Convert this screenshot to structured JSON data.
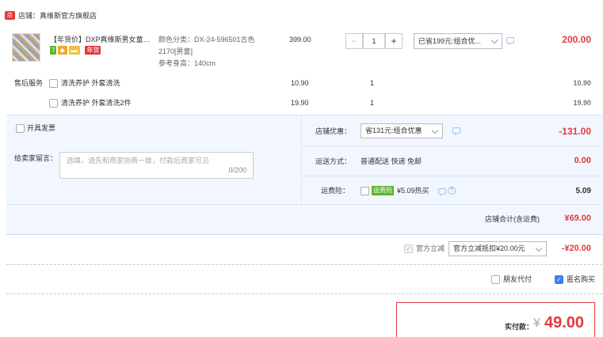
{
  "shop": {
    "label": "店铺：真维斯官方旗舰店"
  },
  "product": {
    "title": "【年货价】DXP真维斯男女童夏...",
    "badge_7": "7",
    "badge_nian": "年货",
    "spec_line1": "颜色分类：DX-24-596501古色",
    "spec_line2": "2170[男童]",
    "spec_line3": "参考身高：140cm",
    "price": "399.00",
    "qty": "1",
    "promo_select": "已省199元:组合优...",
    "subtotal": "200.00"
  },
  "after_sales": {
    "label": "售后服务",
    "items": [
      {
        "name": "清洗养护 外套清洗",
        "price": "10.90",
        "qty": "1",
        "subtotal": "10.90"
      },
      {
        "name": "清洗养护 外套清洗2件",
        "price": "19.90",
        "qty": "1",
        "subtotal": "19.90"
      }
    ]
  },
  "invoice": {
    "label": "开具发票"
  },
  "message": {
    "label": "给卖家留言：",
    "placeholder": "选填，请先和商家协商一致，付款后商家可见",
    "counter": "0/200"
  },
  "discount": {
    "label": "店铺优惠：",
    "select": "省131元:组合优惠",
    "value": "-131.00"
  },
  "shipping": {
    "label": "运送方式：",
    "text": "普通配送 快递 免邮",
    "value": "0.00"
  },
  "insurance": {
    "label": "运费险：",
    "tag": "运费险",
    "text": "¥5.09热买",
    "value": "5.09"
  },
  "shop_total": {
    "label": "店铺合计(含运费)",
    "value": "¥69.00"
  },
  "official_discount": {
    "label": "官方立减",
    "select": "官方立减抵扣¥20.00元",
    "value": "-¥20.00"
  },
  "options": {
    "friend_pay": "朋友代付",
    "anonymous": "匿名购买"
  },
  "payment": {
    "label": "实付款：",
    "currency": "¥",
    "value": "49.00"
  },
  "colors": {
    "accent": "#e4393c",
    "band": "#f2f7ff",
    "badge_green": "#5ab52a",
    "badge_orange": "#f5a623",
    "badge_red": "#e4393c"
  }
}
